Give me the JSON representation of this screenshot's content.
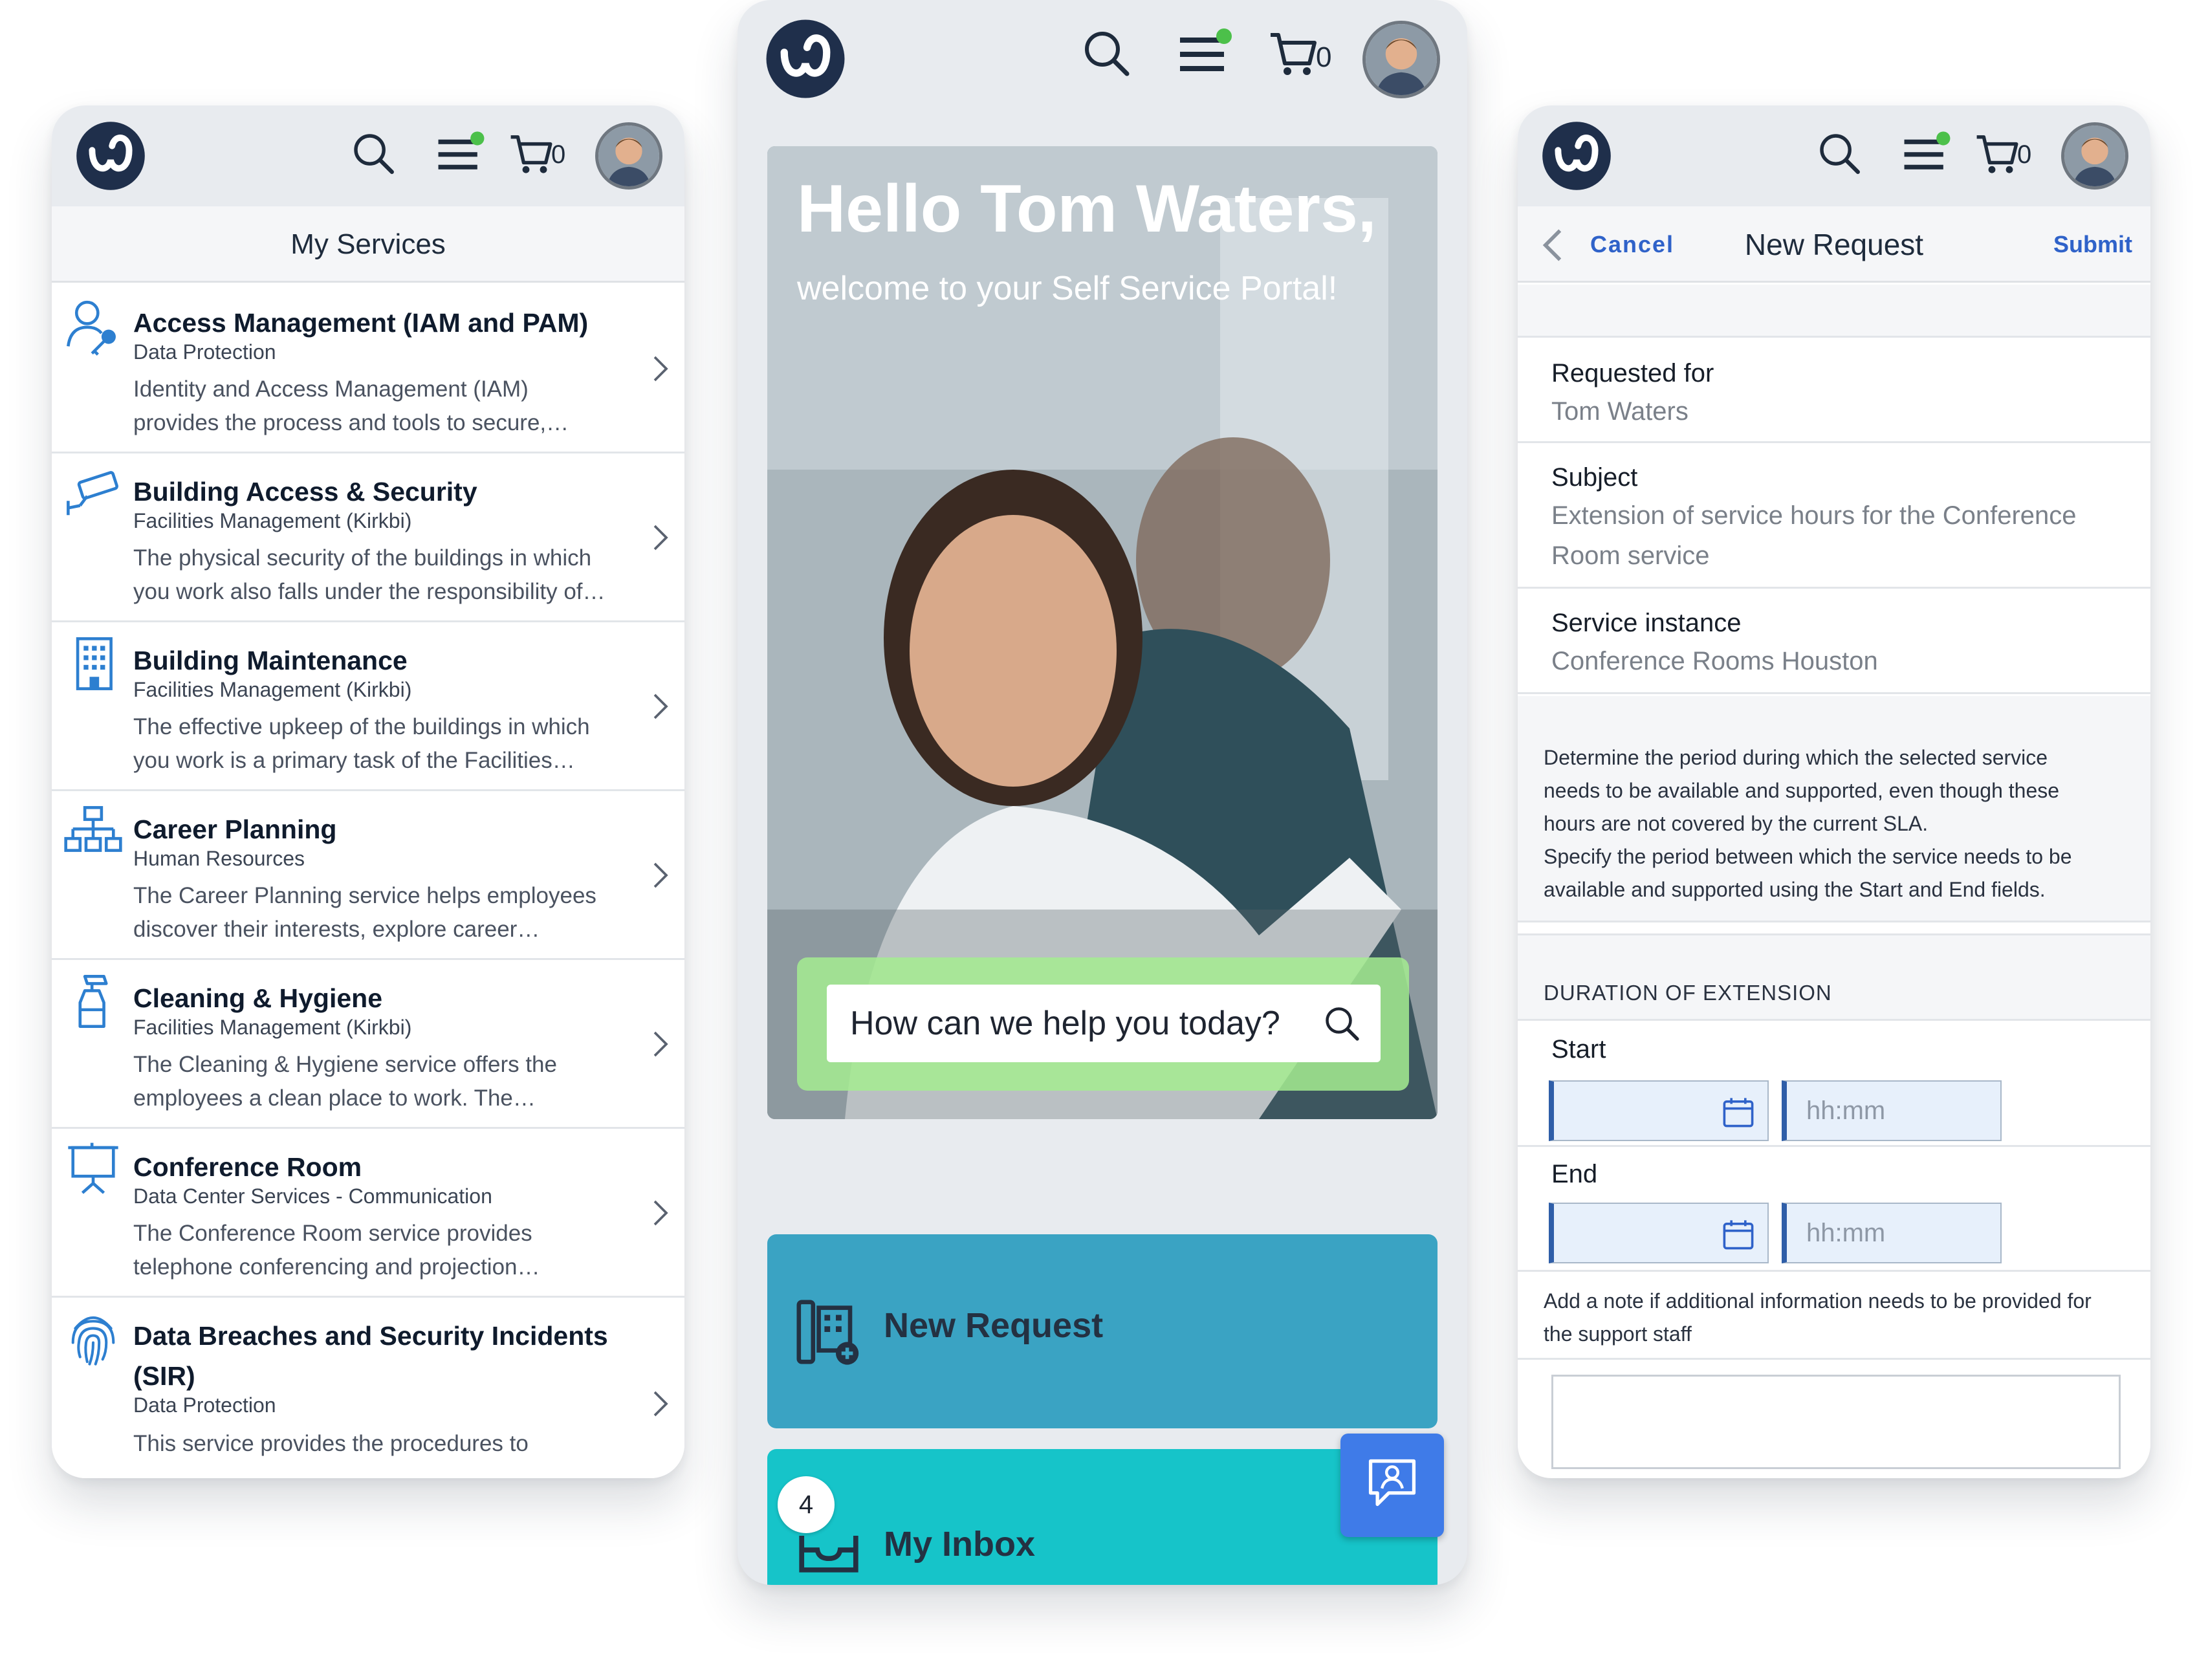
{
  "header": {
    "cart_count": "0",
    "icons": [
      "wx-logo-icon",
      "search-icon",
      "menu-icon",
      "cart-icon",
      "avatar"
    ],
    "notification_dot_color": "#4cc04a"
  },
  "left_panel": {
    "title": "My Services",
    "services": [
      {
        "title": "Access Management (IAM and PAM)",
        "category": "Data Protection",
        "desc1": "Identity and Access Management (IAM)",
        "desc2": "provides the process and tools to secure,…",
        "icon": "user-key-icon"
      },
      {
        "title": "Building Access & Security",
        "category": "Facilities Management (Kirkbi)",
        "desc1": "The physical security of the buildings in which",
        "desc2": "you work also falls under the responsibility of…",
        "icon": "security-camera-icon"
      },
      {
        "title": "Building Maintenance",
        "category": "Facilities Management (Kirkbi)",
        "desc1": "The effective upkeep of the buildings in which",
        "desc2": "you work is a primary task of the Facilities…",
        "icon": "building-icon"
      },
      {
        "title": "Career Planning",
        "category": "Human Resources",
        "desc1": "The Career Planning service helps employees",
        "desc2": "discover their interests, explore career…",
        "icon": "org-chart-icon"
      },
      {
        "title": "Cleaning & Hygiene",
        "category": "Facilities Management (Kirkbi)",
        "desc1": "The Cleaning & Hygiene service offers the",
        "desc2": "employees a clean place to work. The…",
        "icon": "spray-bottle-icon"
      },
      {
        "title": "Conference Room",
        "category": "Data Center Services - Communication",
        "desc1": "The Conference Room service provides",
        "desc2": "telephone conferencing and projection…",
        "icon": "presentation-screen-icon"
      },
      {
        "title": "Data Breaches and Security Incidents (SIR)",
        "category": "Data Protection",
        "desc1": "This service provides the procedures to",
        "desc2": "",
        "icon": "fingerprint-icon"
      }
    ]
  },
  "center_panel": {
    "greeting": "Hello Tom Waters,",
    "subtitle": "welcome to your Self Service Portal!",
    "search_placeholder": "How can we help you today?",
    "tiles": {
      "new_request": "New Request",
      "my_inbox": "My Inbox",
      "inbox_badge": "4"
    },
    "colors": {
      "new_request": "#3aa3c3",
      "my_inbox": "#16c4c9",
      "chat": "#3f7be8",
      "search_band": "#a4ec91"
    }
  },
  "right_panel": {
    "cancel": "Cancel",
    "title": "New Request",
    "submit": "Submit",
    "fields": {
      "requested_for_label": "Requested for",
      "requested_for_value": "Tom Waters",
      "subject_label": "Subject",
      "subject_line1": "Extension of service hours for the Conference",
      "subject_line2": "Room service",
      "service_instance_label": "Service instance",
      "service_instance_value": "Conference Rooms Houston"
    },
    "help": {
      "line1": "Determine the period during which the selected service",
      "line2": "needs to be available and supported, even though these",
      "line3": "hours are not covered by the current SLA.",
      "line4": "Specify the period between which the service needs to be",
      "line5": "available and supported using the Start and End fields."
    },
    "duration_header": "DURATION OF EXTENSION",
    "start_label": "Start",
    "end_label": "End",
    "time_placeholder": "hh:mm",
    "note_line1": "Add a note if additional information needs to be provided for",
    "note_line2": "the support staff"
  }
}
